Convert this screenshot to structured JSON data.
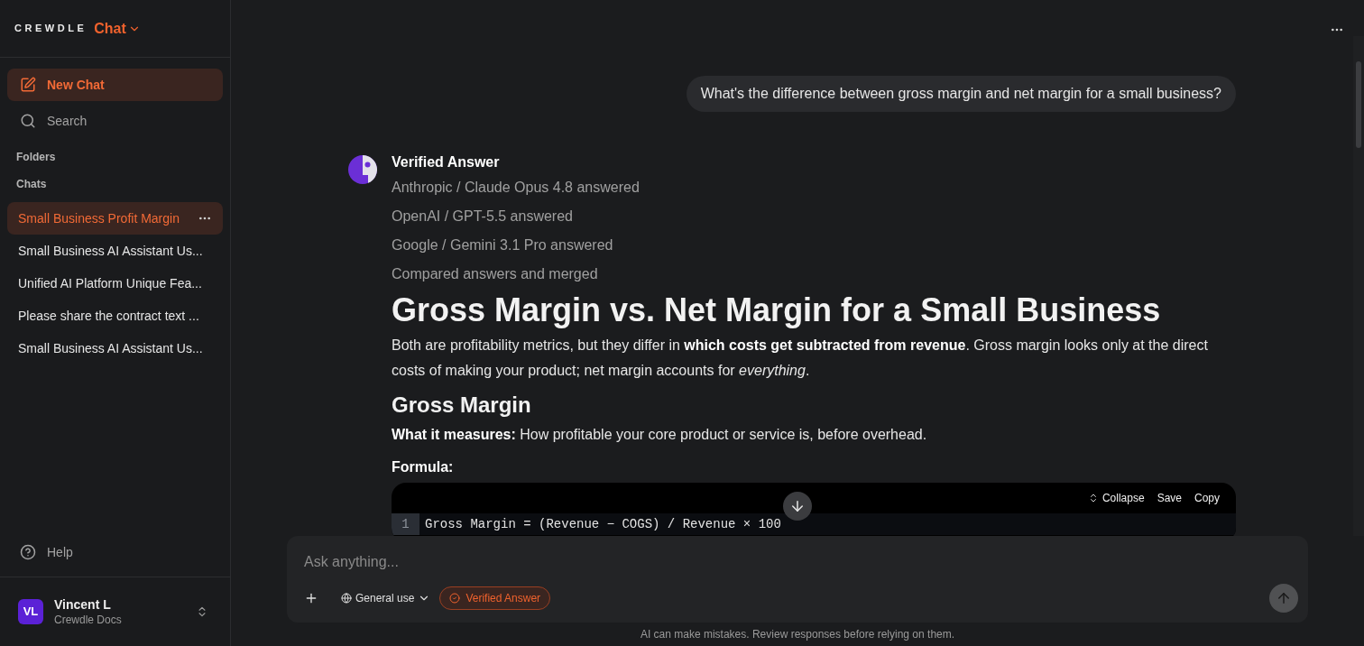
{
  "sidebar": {
    "logo": {
      "brand": "CREWDLE",
      "product": "Chat"
    },
    "new_chat": "New Chat",
    "search": "Search",
    "folders_label": "Folders",
    "chats_label": "Chats",
    "chats": [
      {
        "title": "Small Business Profit Margin",
        "selected": true
      },
      {
        "title": "Small Business AI Assistant Us...",
        "selected": false
      },
      {
        "title": "Unified AI Platform Unique Fea...",
        "selected": false
      },
      {
        "title": "Please share the contract text ...",
        "selected": false
      },
      {
        "title": "Small Business AI Assistant Us...",
        "selected": false
      }
    ],
    "help": "Help",
    "user": {
      "initials": "VL",
      "name": "Vincent L",
      "workspace": "Crewdle Docs"
    }
  },
  "conversation": {
    "user_message": "What's the difference between gross margin and net margin for a small business?",
    "answer": {
      "title": "Verified Answer",
      "steps": [
        "Anthropic / Claude Opus 4.8 answered",
        "OpenAI / GPT-5.5 answered",
        "Google / Gemini 3.1 Pro answered",
        "Compared answers and merged"
      ],
      "blocks": [
        {
          "kind": "heading1",
          "text": "Gross Margin vs. Net Margin for a Small Business"
        },
        {
          "kind": "paragraph",
          "text": "Both are profitability metrics, but they differ in **which costs get subtracted from revenue**. Gross margin looks only at the direct costs of making your product; net margin accounts for *everything*."
        },
        {
          "kind": "heading2",
          "text": "Gross Margin"
        },
        {
          "kind": "paragraph",
          "text": "**What it measures:** How profitable your core product or service is, before overhead."
        },
        {
          "kind": "label",
          "text": "Formula:"
        },
        {
          "kind": "code",
          "actions": [
            {
              "kind": "collapse",
              "label": "Collapse"
            },
            {
              "kind": "save",
              "label": "Save"
            },
            {
              "kind": "copy",
              "label": "Copy"
            }
          ],
          "lines": [
            {
              "number": "1",
              "text": "Gross Margin = (Revenue − COGS) / Revenue × 100"
            }
          ]
        }
      ]
    }
  },
  "composer": {
    "placeholder": "Ask anything...",
    "mode": "General use",
    "verified_toggle": {
      "label": "Verified Answer",
      "on": true
    }
  },
  "disclaimer": "AI can make mistakes. Review responses before relying on them."
}
